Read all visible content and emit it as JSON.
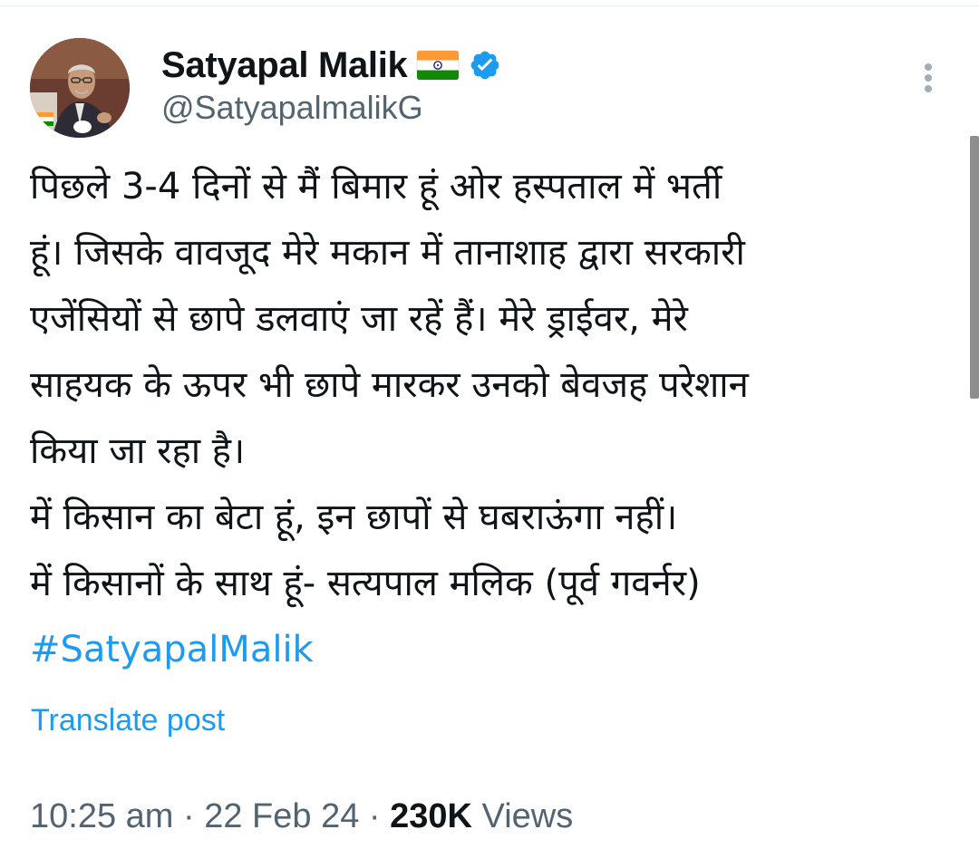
{
  "author": {
    "display_name": "Satyapal Malik",
    "handle": "@SatyapalmalikG",
    "flag_icon": "india-flag-icon",
    "verified_icon": "verified-badge-icon"
  },
  "post": {
    "lines": [
      "पिछले 3-4 दिनों से मैं बिमार हूं ओर हस्पताल में भर्ती",
      "हूं। जिसके वावजूद मेरे मकान में तानाशाह द्वारा सरकारी",
      "एजेंसियों से छापे डलवाएं जा रहें हैं। मेरे ड्राईवर, मेरे",
      "साहयक के ऊपर भी छापे मारकर उनको बेवजह परेशान",
      "किया जा रहा है।",
      "में किसान का बेटा हूं, इन छापों से घबराऊंगा नहीं।",
      "में किसानों के साथ हूं- सत्यपाल मलिक (पूर्व गवर्नर)"
    ],
    "hashtag": "#SatyapalMalik",
    "translate_label": "Translate post"
  },
  "meta": {
    "time": "10:25 am",
    "separator_1": " · ",
    "date": "22 Feb 24",
    "separator_2": " · ",
    "views_count": "230K",
    "views_label": " Views"
  },
  "colors": {
    "link": "#1d9bf0",
    "secondary_text": "#536471",
    "primary_text": "#0f1419"
  }
}
